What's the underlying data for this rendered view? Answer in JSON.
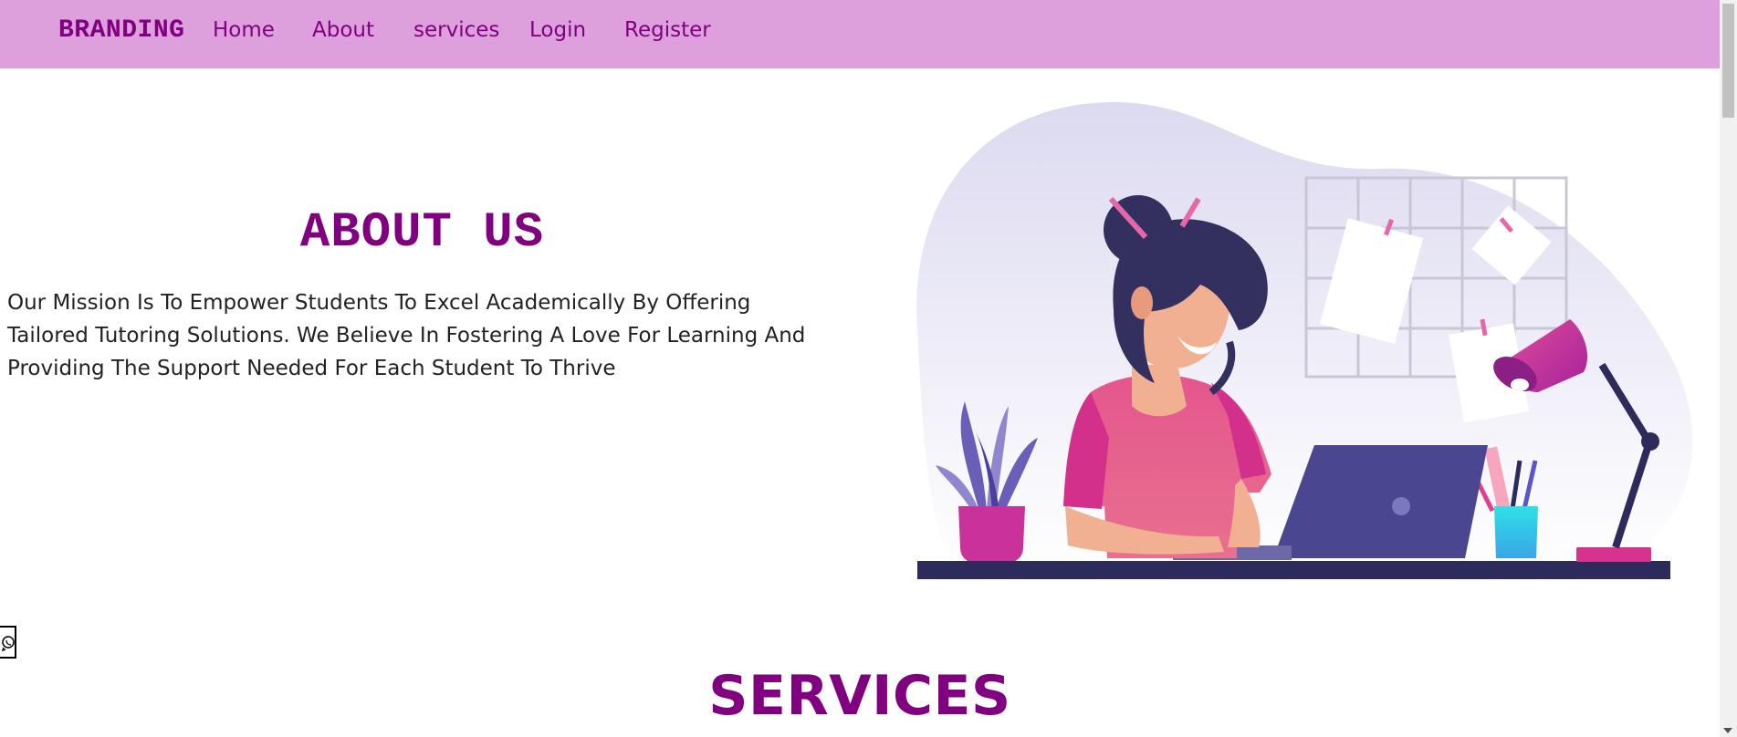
{
  "brand": "BRANDING",
  "nav": {
    "items": [
      {
        "label": "Home"
      },
      {
        "label": "About"
      },
      {
        "label": "services"
      },
      {
        "label": "Login"
      },
      {
        "label": "Register"
      }
    ]
  },
  "about": {
    "title": "ABOUT US",
    "text": "Our Mission Is To Empower Students To Excel Academically By Offering Tailored Tutoring Solutions. We Believe In Fostering A Love For Learning And Providing The Support Needed For Each Student To Thrive"
  },
  "services": {
    "title": "SERVICES"
  },
  "colors": {
    "navbar_bg": "#dda0dd",
    "accent": "#800080"
  },
  "icons": {
    "illustration": "girl-studying-laptop-illustration",
    "whatsapp": "whatsapp-icon"
  }
}
